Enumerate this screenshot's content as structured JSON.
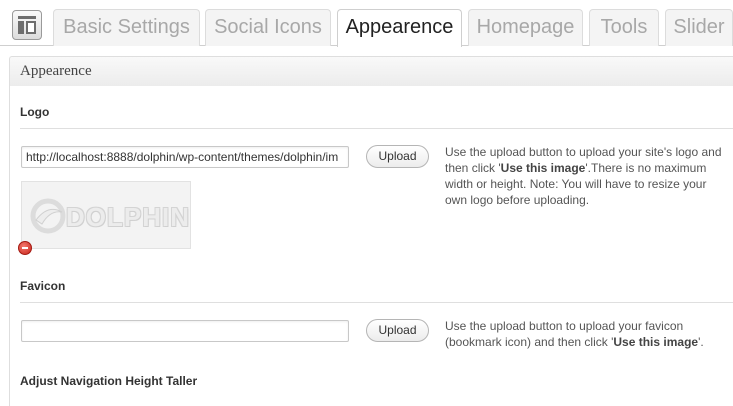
{
  "tabs": [
    {
      "label": "Basic Settings",
      "active": false
    },
    {
      "label": "Social Icons",
      "active": false
    },
    {
      "label": "Appearence",
      "active": true
    },
    {
      "label": "Homepage",
      "active": false
    },
    {
      "label": "Tools",
      "active": false
    },
    {
      "label": "Slider",
      "active": false
    }
  ],
  "panel": {
    "title": "Appearence"
  },
  "logo": {
    "title": "Logo",
    "input_value": "http://localhost:8888/dolphin/wp-content/themes/dolphin/im",
    "upload_label": "Upload",
    "description_pre": "Use the upload button to upload your site's logo and then click '",
    "description_bold": "Use this image",
    "description_post": "'.There is no maximum width or height. Note: You will have to resize your own logo before uploading.",
    "preview_text": "DOLPHIN"
  },
  "favicon": {
    "title": "Favicon",
    "input_value": "",
    "upload_label": "Upload",
    "description_pre": "Use the upload button to upload your favicon (bookmark icon) and then click '",
    "description_bold": "Use this image",
    "description_post": "'."
  },
  "nav_height": {
    "title": "Adjust Navigation Height Taller"
  },
  "icons": {
    "screen": "settings-screen-icon",
    "remove": "remove-icon"
  },
  "colors": {
    "remove": "#c9241a",
    "tab_inactive_text": "#a8a8a8",
    "tab_active_text": "#222222"
  }
}
